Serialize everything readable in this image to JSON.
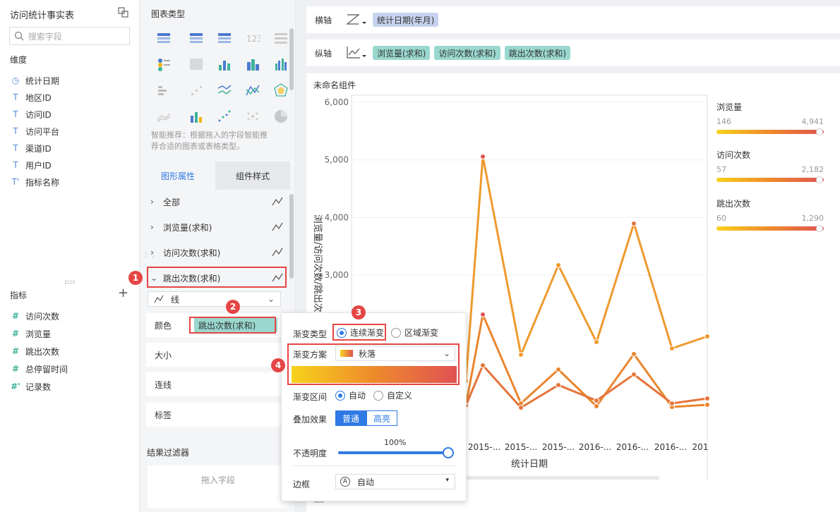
{
  "left": {
    "title": "访问统计事实表",
    "search_placeholder": "搜索字段",
    "dimension_label": "维度",
    "dimensions": [
      {
        "icon": "clock-icon",
        "glyph": "◷",
        "label": "统计日期"
      },
      {
        "icon": "text-field-icon",
        "glyph": "T",
        "label": "地区ID"
      },
      {
        "icon": "text-field-icon",
        "glyph": "T",
        "label": "访问ID"
      },
      {
        "icon": "text-field-icon",
        "glyph": "T",
        "label": "访问平台"
      },
      {
        "icon": "text-field-icon",
        "glyph": "T",
        "label": "渠道ID"
      },
      {
        "icon": "text-field-icon",
        "glyph": "T",
        "label": "用户ID"
      },
      {
        "icon": "text-field-icon",
        "glyph": "T'",
        "label": "指标名称"
      }
    ],
    "measure_label": "指标",
    "add_glyph": "+",
    "measures": [
      {
        "icon": "number-field-icon",
        "glyph": "#",
        "label": "访问次数"
      },
      {
        "icon": "number-field-icon",
        "glyph": "#",
        "label": "浏览量"
      },
      {
        "icon": "number-field-icon",
        "glyph": "#",
        "label": "跳出次数"
      },
      {
        "icon": "number-field-icon",
        "glyph": "#",
        "label": "总停留时间"
      },
      {
        "icon": "number-field-icon",
        "glyph": "#'",
        "label": "记录数"
      }
    ]
  },
  "mid": {
    "chart_type_label": "图表类型",
    "recommend_text_1": "智能推荐：根据拖入的字段智能推",
    "recommend_text_2": "荐合适的图表或表格类型。",
    "tabs": [
      "图形属性",
      "组件样式"
    ],
    "props": [
      {
        "label": "全部"
      },
      {
        "label": "浏览量(求和)"
      },
      {
        "label": "访问次数(求和)"
      },
      {
        "label": "跳出次数(求和)"
      }
    ],
    "line_type": "线",
    "color_label": "颜色",
    "color_field": "跳出次数(求和)",
    "size_label": "大小",
    "connect_label": "连线",
    "tag_label": "标签",
    "filter_label": "结果过滤器",
    "drop_field": "拖入字段"
  },
  "axes": {
    "x_label": "横轴",
    "x_field": "统计日期(年月)",
    "y_label": "纵轴",
    "y_fields": [
      "浏览量(求和)",
      "访问次数(求和)",
      "跳出次数(求和)"
    ]
  },
  "chart": {
    "component_name": "未命名组件",
    "x_axis_title": "统计日期",
    "y_axis_title": "浏览量/访问次数/跳出次",
    "y_ticks": [
      "6,000",
      "5,000",
      "4,000",
      "3,000"
    ],
    "x_ticks": [
      "2015-...",
      "2015-...",
      "2015-...",
      "2016-...",
      "2016-...",
      "2016-...",
      "201"
    ]
  },
  "legend": [
    {
      "name": "浏览量",
      "min": "146",
      "max": "4,941"
    },
    {
      "name": "访问次数",
      "min": "57",
      "max": "2,182"
    },
    {
      "name": "跳出次数",
      "min": "60",
      "max": "1,290"
    }
  ],
  "popup": {
    "gradient_type_label": "渐变类型",
    "continuous": "连续渐变",
    "area": "区域渐变",
    "scheme_label": "渐变方案",
    "scheme_name": "秋落",
    "range_label": "渐变区间",
    "auto": "自动",
    "custom": "自定义",
    "overlay_label": "叠加效果",
    "normal": "普通",
    "highlight": "高亮",
    "opacity_label": "不透明度",
    "opacity_value": "100%",
    "opacity": 1.0,
    "border_label": "边框",
    "border_value": "自动"
  },
  "badges": [
    "1",
    "2",
    "3",
    "4"
  ],
  "colors": {
    "accent": "#2f7ae5",
    "teal_pill": "#9ad8cf",
    "blue_pill": "#c7d3ee",
    "highlight_box": "#e64545",
    "gradient_start": "#f7d21c",
    "gradient_end": "#e05252"
  }
}
